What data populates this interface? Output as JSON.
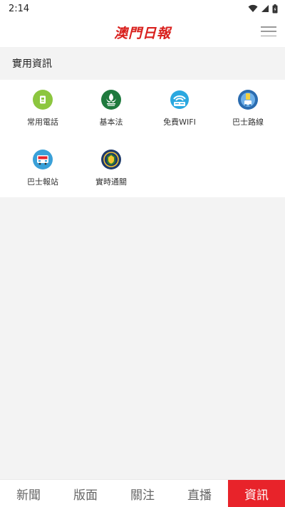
{
  "status_bar": {
    "time": "2:14"
  },
  "header": {
    "logo_text": "澳門日報"
  },
  "section": {
    "title": "實用資訊"
  },
  "grid": {
    "items": [
      {
        "label": "常用電話",
        "icon": "phone-book-icon",
        "color": "#8cc63f"
      },
      {
        "label": "基本法",
        "icon": "basic-law-emblem-icon",
        "color": "#1f7a3e"
      },
      {
        "label": "免費WIFI",
        "icon": "free-wifi-icon",
        "color": "#2aa8e0"
      },
      {
        "label": "巴士路線",
        "icon": "bus-route-icon",
        "color": "#2b6cb0"
      },
      {
        "label": "巴士報站",
        "icon": "bus-stop-icon",
        "color": "#3aa0d8"
      },
      {
        "label": "實時通關",
        "icon": "border-crossing-icon",
        "color": "#1e3a6b"
      }
    ]
  },
  "bottom_nav": {
    "tabs": [
      {
        "label": "新聞",
        "active": false
      },
      {
        "label": "版面",
        "active": false
      },
      {
        "label": "關注",
        "active": false
      },
      {
        "label": "直播",
        "active": false
      },
      {
        "label": "資訊",
        "active": true
      }
    ]
  },
  "colors": {
    "brand_red": "#d9201d",
    "active_tab": "#e8232a"
  }
}
